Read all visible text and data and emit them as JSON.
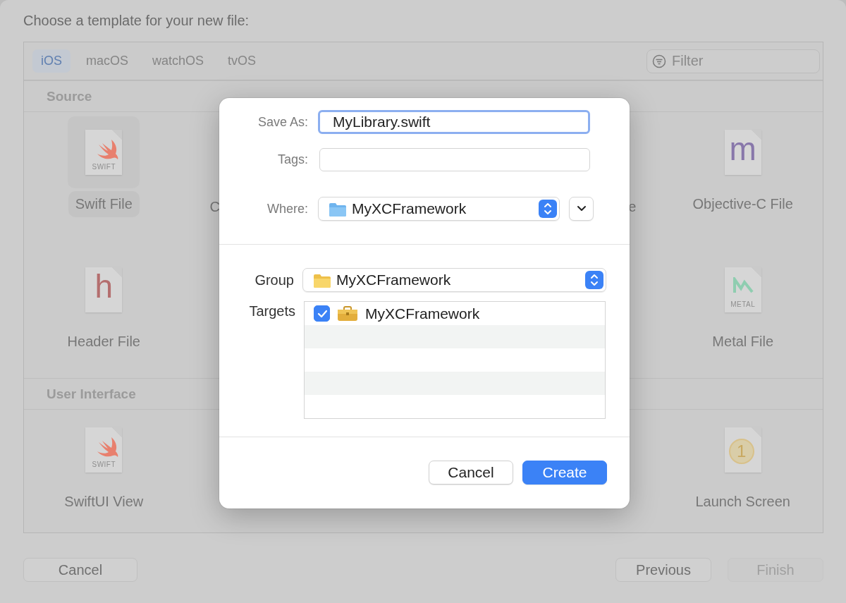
{
  "window": {
    "title": "Choose a template for your new file:"
  },
  "platform_tabs": [
    {
      "label": "iOS",
      "selected": true
    },
    {
      "label": "macOS",
      "selected": false
    },
    {
      "label": "watchOS",
      "selected": false
    },
    {
      "label": "tvOS",
      "selected": false
    }
  ],
  "filter": {
    "placeholder": "Filter"
  },
  "sections": [
    {
      "title": "Source",
      "rows": [
        [
          {
            "kind": "file",
            "label": "Swift File",
            "selected": true,
            "icon": {
              "kind": "swift",
              "caption": "SWIFT"
            }
          },
          {
            "kind": "fragment",
            "label": "C"
          },
          null,
          {
            "kind": "fragment",
            "label": "e"
          },
          {
            "kind": "file",
            "label": "Objective-C File",
            "selected": false,
            "icon": {
              "kind": "letter",
              "glyph": "m",
              "color": "#8877aa"
            }
          }
        ],
        [
          {
            "kind": "file",
            "label": "Header File",
            "selected": false,
            "icon": {
              "kind": "letter",
              "glyph": "h",
              "color": "#b46e6e"
            }
          },
          null,
          null,
          null,
          {
            "kind": "file",
            "label": "Metal File",
            "selected": false,
            "icon": {
              "kind": "metal",
              "caption": "METAL"
            }
          }
        ]
      ]
    },
    {
      "title": "User Interface",
      "rows": [
        [
          {
            "kind": "file",
            "label": "SwiftUI View",
            "selected": false,
            "icon": {
              "kind": "swift",
              "caption": "SWIFT"
            }
          },
          null,
          null,
          null,
          {
            "kind": "file",
            "label": "Launch Screen",
            "selected": false,
            "icon": {
              "kind": "badge",
              "glyph": "1"
            }
          }
        ]
      ]
    }
  ],
  "footer_buttons": [
    {
      "label": "Cancel",
      "disabled": false
    },
    {
      "label": "Previous",
      "disabled": false
    },
    {
      "label": "Finish",
      "disabled": true
    }
  ],
  "save_dialog": {
    "save_as": {
      "label": "Save As:",
      "value": "MyLibrary.swift",
      "focused": true
    },
    "tags": {
      "label": "Tags:"
    },
    "where": {
      "label": "Where:",
      "value": "MyXCFramework"
    },
    "group": {
      "label": "Group",
      "value": "MyXCFramework"
    },
    "targets": {
      "label": "Targets",
      "items": [
        {
          "name": "MyXCFramework",
          "checked": true
        }
      ]
    },
    "buttons": [
      {
        "label": "Cancel",
        "kind": "normal"
      },
      {
        "label": "Create",
        "kind": "default"
      }
    ]
  }
}
